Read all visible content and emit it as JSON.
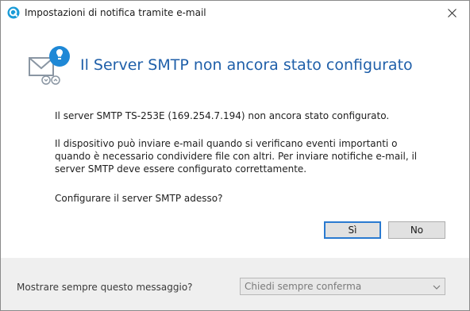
{
  "window": {
    "title": "Impostazioni di notifica tramite e-mail"
  },
  "dialog": {
    "heading": "Il Server SMTP non ancora stato configurato",
    "message1": "Il server SMTP TS-253E (169.254.7.194) non ancora stato configurato.",
    "message2": "Il dispositivo può inviare e-mail quando si verificano eventi importanti o quando è necessario condividere file con altri. Per inviare notifiche e-mail, il server SMTP deve essere configurato correttamente.",
    "question": "Configurare il server SMTP adesso?",
    "yes_label": "Sì",
    "no_label": "No"
  },
  "footer": {
    "label": "Mostrare sempre questo messaggio?",
    "dropdown_value": "Chiedi sempre conferma"
  },
  "colors": {
    "heading": "#1f5fa9",
    "accent": "#1e88d6",
    "footer_bg": "#efefef"
  },
  "icons": {
    "app": "qnap-q-icon",
    "header": "mail-alert-icon",
    "close": "close-icon",
    "dropdown": "chevron-down-icon"
  }
}
